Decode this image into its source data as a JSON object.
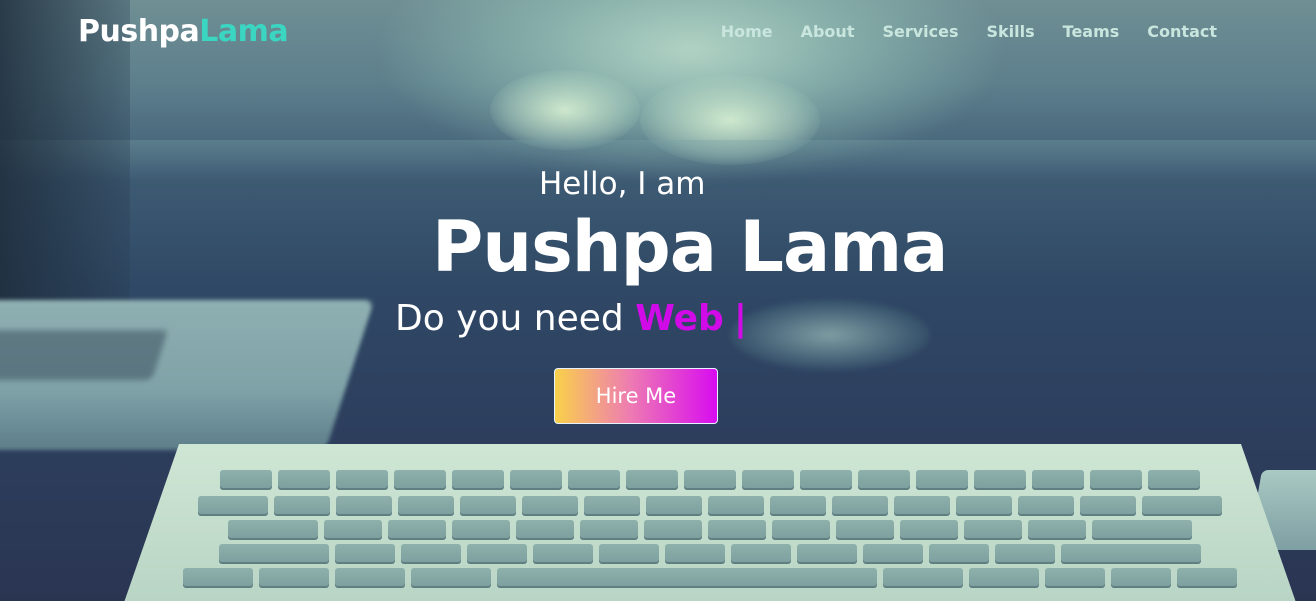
{
  "brand": {
    "first": "Pushpa",
    "second": "Lama"
  },
  "nav": {
    "items": [
      {
        "label": "Home"
      },
      {
        "label": "About"
      },
      {
        "label": "Services"
      },
      {
        "label": "Skills"
      },
      {
        "label": "Teams"
      },
      {
        "label": "Contact"
      }
    ]
  },
  "hero": {
    "greeting": "Hello, I am",
    "name": "Pushpa Lama",
    "tagline_prefix": "Do you need",
    "typed_word": "Web",
    "typing_cursor": "|",
    "cta_label": "Hire Me"
  },
  "colors": {
    "brand_accent": "#3ad6c2",
    "typed_accent": "#d10ae8",
    "button_gradient_start": "#f9d14a",
    "button_gradient_end": "#d80cf0",
    "nav_text": "#c9e6de"
  }
}
